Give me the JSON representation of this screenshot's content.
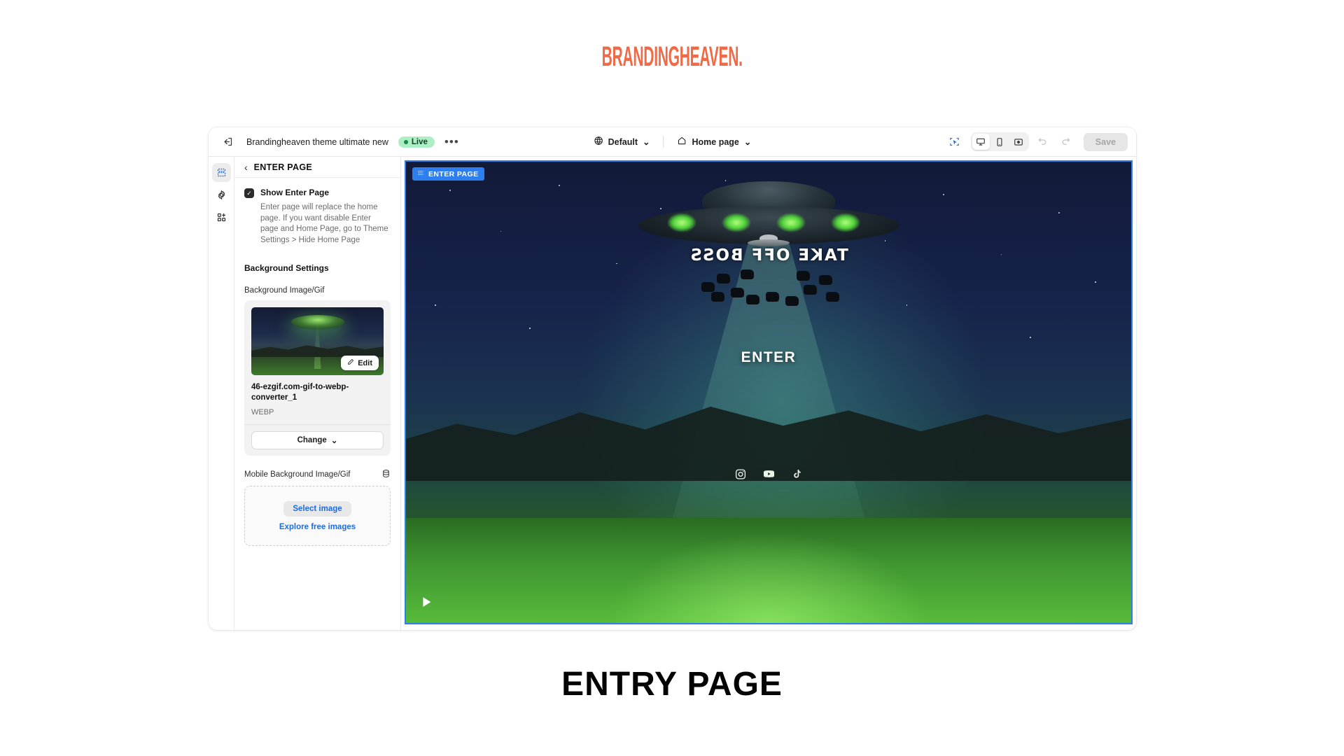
{
  "brand": {
    "logo_text": "BRANDINGHEAVEN."
  },
  "topbar": {
    "exit_icon": "exit-icon",
    "theme_name": "Brandingheaven theme ultimate new",
    "status_badge": "Live",
    "more_options": "•••",
    "theme_selector": {
      "icon": "globe-icon",
      "label": "Default",
      "chevron": "⌄"
    },
    "page_selector": {
      "icon": "home-icon",
      "label": "Home page",
      "chevron": "⌄"
    },
    "tools": {
      "select_tool": "select-tool-icon",
      "desktop": "desktop-icon",
      "mobile": "mobile-icon",
      "fullscreen": "fullscreen-icon",
      "undo": "undo-icon",
      "redo": "redo-icon",
      "save_label": "Save"
    },
    "accent_color": "#1d6ce0",
    "live_color": "#aeeec4"
  },
  "rail": {
    "items": [
      {
        "name": "sections-icon",
        "active": true
      },
      {
        "name": "gear-icon",
        "active": false
      },
      {
        "name": "apps-add-icon",
        "active": false
      }
    ]
  },
  "panel": {
    "back_chevron": "‹",
    "title": "ENTER PAGE",
    "checkbox": {
      "label": "Show Enter Page",
      "checked": true,
      "help": "Enter page will replace the home page. If you want disable Enter page and Home Page, go to Theme Settings > Hide Home Page"
    },
    "section_title": "Background Settings",
    "background": {
      "field_label": "Background Image/Gif",
      "edit_label": "Edit",
      "file_name": "46-ezgif.com-gif-to-webp-converter_1",
      "file_type": "WEBP",
      "change_label": "Change",
      "change_chevron": "⌄"
    },
    "mobile_background": {
      "field_label": "Mobile Background Image/Gif",
      "db_icon": "database-icon",
      "select_label": "Select image",
      "explore_label": "Explore free images"
    }
  },
  "canvas": {
    "section_badge": "ENTER PAGE",
    "badge_icon": "section-icon",
    "enter_label": "ENTER",
    "ufo_text": "TAKE OFF BOSS",
    "socials": [
      {
        "name": "instagram-icon"
      },
      {
        "name": "youtube-icon"
      },
      {
        "name": "tiktok-icon"
      }
    ],
    "play_icon": "play-icon",
    "border_color": "#2f7ef0"
  },
  "caption": {
    "text": "ENTRY PAGE"
  }
}
